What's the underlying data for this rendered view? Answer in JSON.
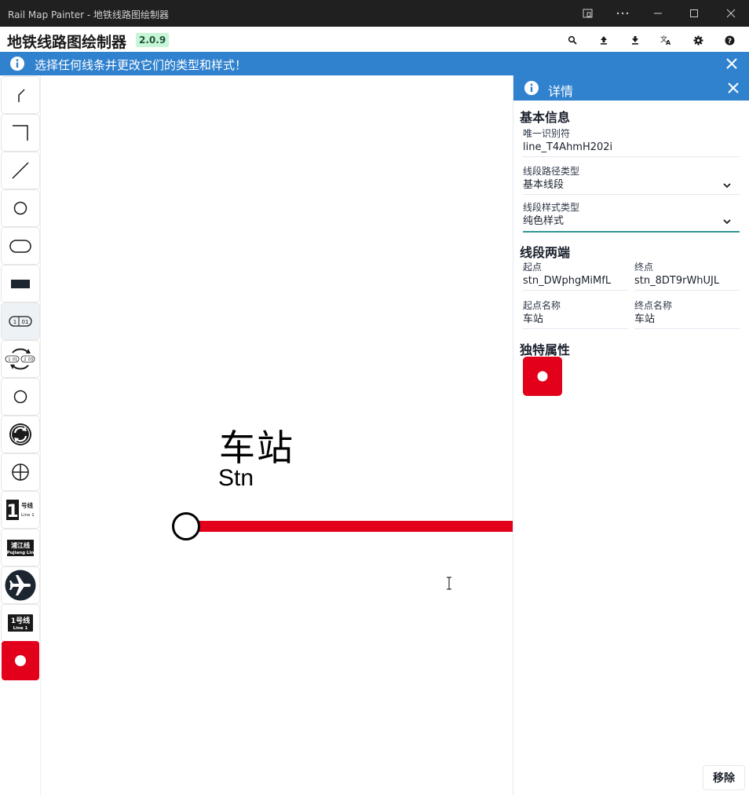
{
  "window": {
    "title": "Rail Map Painter - 地铁线路图绘制器",
    "controls": [
      "restore-icon",
      "more-icon",
      "minimize-icon",
      "maximize-icon",
      "close-icon"
    ]
  },
  "app": {
    "title": "地铁线路图绘制器",
    "version": "2.0.9",
    "toolbar_icons": [
      "search-icon",
      "upload-icon",
      "download-icon",
      "translate-icon",
      "settings-icon",
      "help-icon"
    ]
  },
  "banner": {
    "message": "选择任何线条并更改它们的类型和样式！"
  },
  "palette": {
    "items": [
      {
        "name": "diagonal-line-tool-icon"
      },
      {
        "name": "perpendicular-line-tool-icon"
      },
      {
        "name": "straight-line-tool-icon"
      },
      {
        "name": "circle-station-tool-icon"
      },
      {
        "name": "pill-station-tool-icon"
      },
      {
        "name": "rect-station-tool-icon"
      },
      {
        "name": "interchange-station-tool-icon",
        "labels": [
          "1",
          "01"
        ]
      },
      {
        "name": "multi-interchange-tool-icon",
        "labels": [
          "1",
          "01",
          "2",
          "03"
        ]
      },
      {
        "name": "small-circle-tool-icon"
      },
      {
        "name": "osi-interchange-tool-icon"
      },
      {
        "name": "crosshair-station-tool-icon"
      },
      {
        "name": "line-badge-tool-icon",
        "labels": [
          "1",
          "号线",
          "Line 1"
        ]
      },
      {
        "name": "named-line-badge-tool-icon",
        "labels": [
          "浦江线",
          "Pujiang Lin"
        ]
      },
      {
        "name": "airport-tool-icon"
      },
      {
        "name": "line-name-badge-tool-icon",
        "labels": [
          "1号线",
          "Line 1"
        ]
      },
      {
        "name": "solid-color-style-tool-icon"
      }
    ]
  },
  "canvas": {
    "station_name": "车站",
    "station_name_en": "Stn",
    "line_color": "#e2001a"
  },
  "details": {
    "header": "详情",
    "basic_info": {
      "heading": "基本信息",
      "id_label": "唯一识别符",
      "id_value": "line_T4AhmH202i",
      "path_type_label": "线段路径类型",
      "path_type_value": "基本线段",
      "style_type_label": "线段样式类型",
      "style_type_value": "纯色样式"
    },
    "ends": {
      "heading": "线段两端",
      "from_label": "起点",
      "from_value": "stn_DWphgMiMfL",
      "to_label": "终点",
      "to_value": "stn_8DT9rWhUJL",
      "from_name_label": "起点名称",
      "from_name_value": "车站",
      "to_name_label": "终点名称",
      "to_name_value": "车站"
    },
    "unique": {
      "heading": "独特属性"
    },
    "remove_label": "移除"
  },
  "colors": {
    "accent": "#3182ce",
    "line_red": "#e2001a",
    "version_bg": "#c6f6d5",
    "focus": "#319795"
  }
}
